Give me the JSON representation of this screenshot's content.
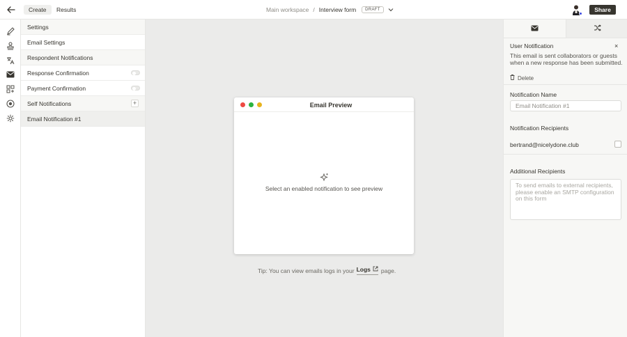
{
  "topbar": {
    "tabs": [
      {
        "label": "Create",
        "active": true
      },
      {
        "label": "Results",
        "active": false
      }
    ],
    "breadcrumb": {
      "workspace": "Main workspace",
      "separator": "/",
      "form": "Interview form",
      "status": "DRAFT"
    },
    "share_label": "Share"
  },
  "rail": {
    "icons": [
      "pencil-icon",
      "stamp-icon",
      "translate-icon",
      "mail-icon",
      "integrations-icon",
      "globe-icon",
      "settings-icon"
    ],
    "active": "mail-icon"
  },
  "panel": {
    "settings_label": "Settings",
    "email_settings_label": "Email Settings",
    "respondent_label": "Respondent Notifications",
    "response_confirmation_label": "Response Confirmation",
    "payment_confirmation_label": "Payment Confirmation",
    "self_label": "Self Notifications",
    "self_item_label": "Email Notification #1"
  },
  "canvas": {
    "window_title": "Email Preview",
    "empty_message": "Select an enabled notification to see preview",
    "tip_text": "Tip: You can view emails logs in your",
    "logs_link": "Logs",
    "tip_after": "page.",
    "light_colors": [
      "#ee4a43",
      "#2bb33f",
      "#e7b31d"
    ]
  },
  "rpanel": {
    "heading": "User Notification",
    "close_glyph": "×",
    "description": "This email is sent collaborators or guests when a new response has been submitted.",
    "delete_label": "Delete",
    "name_label": "Notification Name",
    "name_placeholder": "Email Notification #1",
    "recipients_label": "Notification Recipients",
    "recipient_email": "bertrand@nicelydone.club",
    "additional_label": "Additional Recipients",
    "additional_placeholder": "To send emails to external recipients, please enable an SMTP configuration on this form"
  },
  "colors": {
    "share_bg": "#37352f",
    "canvas_bg": "#ebebea",
    "accent_dot": "#3b49e0"
  }
}
